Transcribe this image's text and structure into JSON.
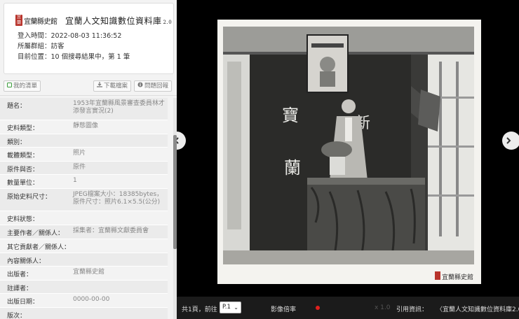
{
  "header": {
    "logo_text": "宜蘭縣史館",
    "logo_seal": "宜蘭",
    "site_title": "宜蘭人文知識數位資料庫",
    "site_version": "2.0",
    "login_time": "登入時間：2022-08-03 11:36:52",
    "group": "所屬群組：訪客",
    "location": "目前位置：10 個搜尋結果中，第 1 筆"
  },
  "toolbar": {
    "my_list": "我的清單",
    "download": "下載檔案",
    "feedback": "問題回報"
  },
  "metadata": [
    {
      "key": "題名：",
      "value": "1953年宜蘭縣風景審查委員林才添發言實況(2)"
    },
    {
      "key": "史料類型：",
      "value": "靜態圖像"
    },
    {
      "key": "類別：",
      "value": ""
    },
    {
      "key": "載體類型：",
      "value": "照片"
    },
    {
      "key": "原件與否：",
      "value": "原件"
    },
    {
      "key": "數量單位：",
      "value": "1"
    },
    {
      "key": "原始史料尺寸：",
      "value": "JPEG檔案大小：18385bytes，原件尺寸：照片6.1×5.5(公分)"
    },
    {
      "key": "史料狀態：",
      "value": ""
    },
    {
      "key": "主要作者／關係人：",
      "value": "採集者：宜蘭縣文獻委員會"
    },
    {
      "key": "其它貢獻者／關係人：",
      "value": ""
    },
    {
      "key": "內容關係人：",
      "value": ""
    },
    {
      "key": "出版者：",
      "value": "宜蘭縣史館"
    },
    {
      "key": "註譯者：",
      "value": ""
    },
    {
      "key": "出版日期：",
      "value": "0000-00-00"
    },
    {
      "key": "版次：",
      "value": ""
    }
  ],
  "viewer": {
    "photo_banner": "寶 蘭",
    "photo_banner_right": "新",
    "watermark": "宜蘭縣史館",
    "prev_icon": "chevron-left-icon",
    "next_icon": "chevron-right-icon"
  },
  "bottom_bar": {
    "total_goto": "共1頁，前往",
    "page_value": "P.1",
    "zoom_label": "影像倍率",
    "zoom_value": "x 1.0",
    "cite_label": "引用資訊：",
    "cite_value": "〈宜蘭人文知識數位資料庫2.0"
  }
}
